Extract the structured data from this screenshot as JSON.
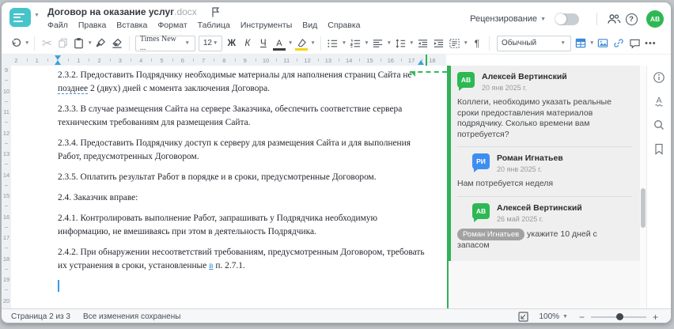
{
  "window": {
    "title": "Договор на оказание услуг",
    "ext": ".docx"
  },
  "menu": {
    "items": [
      "Файл",
      "Правка",
      "Вставка",
      "Формат",
      "Таблица",
      "Инструменты",
      "Вид",
      "Справка"
    ]
  },
  "topbar": {
    "review": "Рецензирование",
    "avatar": "АВ"
  },
  "toolbar": {
    "font_name": "Times New ...",
    "font_size": "12",
    "bold": "Ж",
    "italic": "К",
    "underline": "Ч",
    "color_letter": "А",
    "style": "Обычный",
    "pilcrow": "¶",
    "more": "•••"
  },
  "ruler": {
    "h_min": -2,
    "h_max": 18,
    "v_min": 9,
    "v_max": 20
  },
  "document": {
    "paragraphs": [
      [
        {
          "t": "2.3.2. Предоставить Подрядчику необходимые материалы для наполнения страниц Сайта не "
        },
        {
          "t": "позднее",
          "s": "dashed"
        },
        {
          "t": " 2 (двух) дней с момента заключения Договора."
        }
      ],
      [
        {
          "t": "2.3.3. В случае размещения Сайта на сервере Заказчика, обеспечить соответствие сервера техническим требованиям для размещения Сайта."
        }
      ],
      [
        {
          "t": "2.3.4. Предоставить Подрядчику доступ к серверу для размещения Сайта и для выполнения Работ, предусмотренных Договором."
        }
      ],
      [
        {
          "t": "2.3.5. Оплатить результат Работ в порядке и в сроки, предусмотренные Договором."
        }
      ],
      [
        {
          "t": "2.4. Заказчик вправе:"
        }
      ],
      [
        {
          "t": "2.4.1. Контролировать выполнение Работ, запрашивать у Подрядчика необходимую информацию, не вмешиваясь при этом в деятельность Подрядчика."
        }
      ],
      [
        {
          "t": "2.4.2. При обнаружении несоответствий требованиям, предусмотренным Договором, требовать их устранения в сроки, установленные "
        },
        {
          "t": "в",
          "s": "ins"
        },
        {
          "t": " п. 2.7.1."
        }
      ]
    ]
  },
  "comments": {
    "accent": "#31b158",
    "items": [
      {
        "initials": "АВ",
        "color": "#2eb854",
        "name": "Алексей Вертинский",
        "date": "20 янв 2025 г.",
        "text": "Коллеги, необходимо указать реальные сроки предоставления материалов подрядчику. Сколько времени вам потребуется?",
        "reply": false
      },
      {
        "initials": "РИ",
        "color": "#3e8ef0",
        "name": "Роман Игнатьев",
        "date": "20 янв 2025 г.",
        "text": "Нам потребуется неделя",
        "reply": true
      },
      {
        "initials": "АВ",
        "color": "#2eb854",
        "name": "Алексей Вертинский",
        "date": "26 май 2025 г.",
        "mention": "Роман Игнатьев",
        "text": "укажите 10 дней с запасом",
        "reply": true
      }
    ]
  },
  "statusbar": {
    "page": "Страница 2 из 3",
    "saved": "Все изменения сохранены",
    "zoom": "100%"
  }
}
